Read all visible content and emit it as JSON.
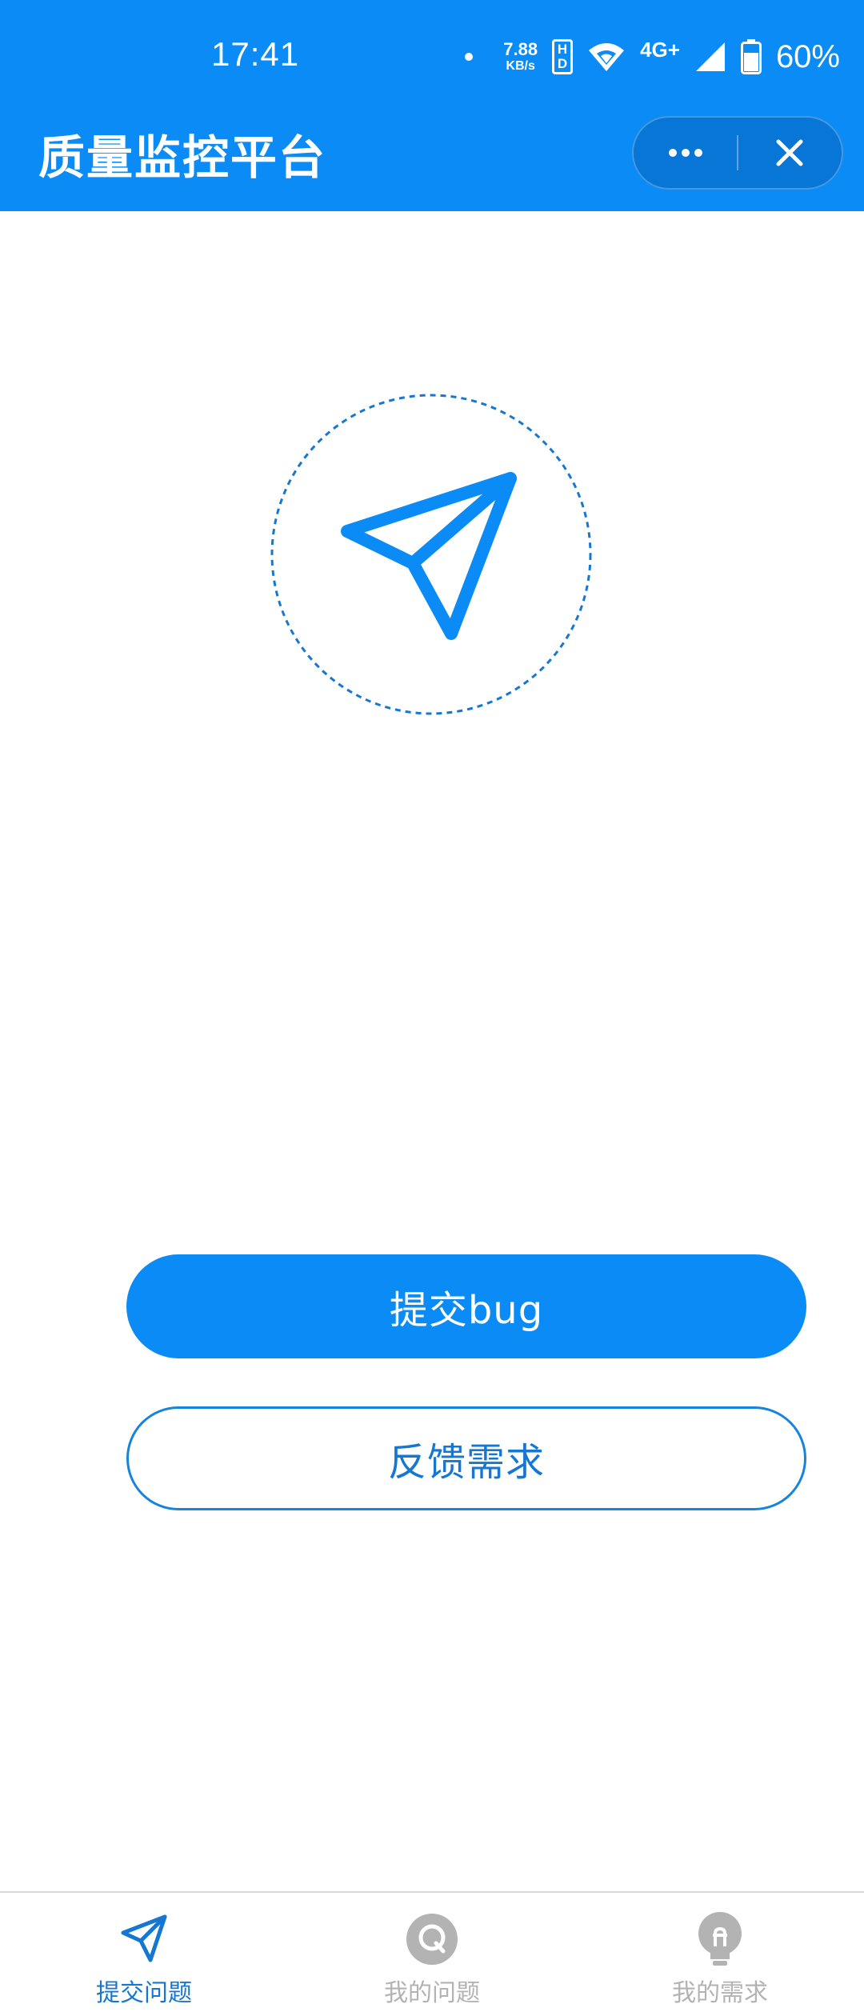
{
  "status_bar": {
    "time": "17:41",
    "net_speed_value": "7.88",
    "net_speed_unit": "KB/s",
    "hd_label_top": "H",
    "hd_label_bottom": "D",
    "network_type": "4G+",
    "battery_percent": "60%"
  },
  "header": {
    "title": "质量监控平台",
    "more_icon": "more-dots-icon",
    "close_icon": "close-icon"
  },
  "hero": {
    "icon": "paper-plane-icon"
  },
  "actions": {
    "submit_bug_label": "提交bug",
    "feedback_label": "反馈需求"
  },
  "tabbar": {
    "tabs": [
      {
        "label": "提交问题",
        "icon": "paper-plane-icon",
        "active": true
      },
      {
        "label": "我的问题",
        "icon": "question-circle-icon",
        "active": false
      },
      {
        "label": "我的需求",
        "icon": "lightbulb-icon",
        "active": false
      }
    ]
  },
  "colors": {
    "primary": "#0a8bf5",
    "primary_dark": "#0876d6",
    "accent_text": "#1677d2",
    "inactive": "#b3b3b3"
  }
}
